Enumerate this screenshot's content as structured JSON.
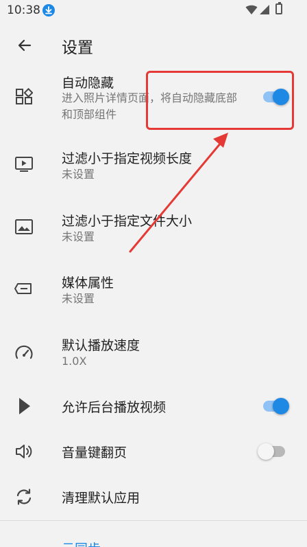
{
  "status_bar": {
    "time": "10:38",
    "icons": [
      "download-icon",
      "wifi-icon",
      "signal-icon",
      "battery-icon"
    ]
  },
  "app_bar": {
    "title": "设置",
    "back_icon": "arrow-left-icon"
  },
  "settings": [
    {
      "title": "自动隐藏",
      "summary": "进入照片详情页面，将自动隐藏底部和顶部组件",
      "icon": "widgets-icon",
      "switch": "on"
    },
    {
      "title": "过滤小于指定视频长度",
      "summary": "未设置",
      "icon": "tv-play-icon"
    },
    {
      "title": "过滤小于指定文件大小",
      "summary": "未设置",
      "icon": "image-icon"
    },
    {
      "title": "媒体属性",
      "summary": "未设置",
      "icon": "tag-icon"
    },
    {
      "title": "默认播放速度",
      "summary": "1.0X",
      "icon": "speed-icon"
    },
    {
      "title": "允许后台播放视频",
      "icon": "play-icon",
      "switch": "on"
    },
    {
      "title": "音量键翻页",
      "icon": "volume-icon",
      "switch": "off"
    },
    {
      "title": "清理默认应用",
      "icon": "sync-icon"
    }
  ],
  "section_label": "云同步",
  "colors": {
    "accent": "#1e88e5",
    "annotation": "#e53935",
    "background": "#f2f2f2"
  }
}
